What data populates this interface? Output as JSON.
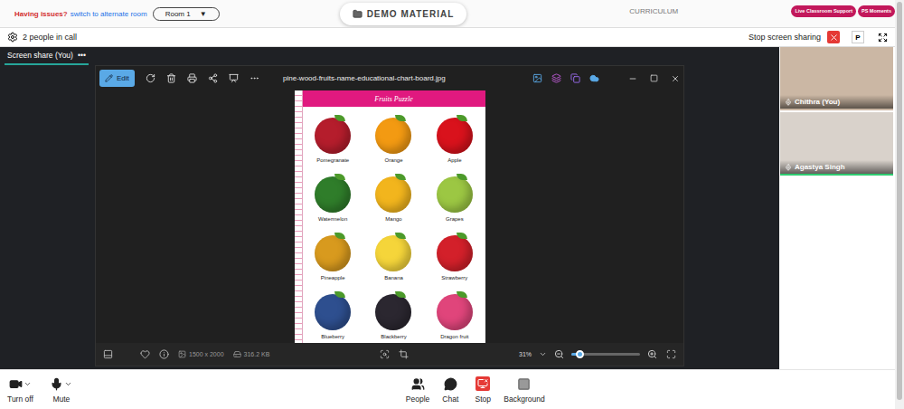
{
  "top_bar": {
    "issue_text": "Having issues?",
    "switch_link": "switch to alternate room",
    "room": "Room 1",
    "room_caret": "▼",
    "tabs": [
      {
        "label": "DEMO MATERIAL",
        "selected": true
      },
      {
        "label": "CURRICULUM",
        "selected": false
      }
    ],
    "actions": [
      "Live Classroom Support",
      "PS Moments"
    ]
  },
  "call_bar": {
    "people_count": "2 people in call",
    "stop_sharing": "Stop screen sharing",
    "avatar": "P"
  },
  "share_tab": {
    "label": "Screen share (You)",
    "menu": "•••",
    "selected": true
  },
  "viewer": {
    "edit": "Edit",
    "title": "pine-wood-fruits-name-educational-chart-board.jpg",
    "image_size": "1500 x 2000",
    "file_size": "316.2 KB",
    "zoom": "31%",
    "zoom_level": 0.12
  },
  "chart": {
    "title": "Fruits Puzzle",
    "fruits": [
      {
        "name": "Pomegranate",
        "color": "#b51d2c"
      },
      {
        "name": "Orange",
        "color": "#f39a12"
      },
      {
        "name": "Apple",
        "color": "#d9121c"
      },
      {
        "name": "Watermelon",
        "color": "#2f7d2a"
      },
      {
        "name": "Mango",
        "color": "#f2b51d"
      },
      {
        "name": "Grapes",
        "color": "#9cc743"
      },
      {
        "name": "Pineapple",
        "color": "#d89a1e"
      },
      {
        "name": "Banana",
        "color": "#f5d53a"
      },
      {
        "name": "Strawberry",
        "color": "#d3202a"
      },
      {
        "name": "Blueberry",
        "color": "#2e4f8f"
      },
      {
        "name": "Blackberry",
        "color": "#2b2730"
      },
      {
        "name": "Dragon fruit",
        "color": "#e0457b"
      }
    ]
  },
  "participants": [
    {
      "name": "Chithra (You)",
      "speaking": false
    },
    {
      "name": "Agastya Singh",
      "speaking": true
    }
  ],
  "controls": {
    "left": [
      {
        "label": "Turn off"
      },
      {
        "label": "Mute"
      }
    ],
    "center": [
      {
        "label": "People"
      },
      {
        "label": "Chat"
      },
      {
        "label": "Stop"
      },
      {
        "label": "Background"
      }
    ]
  }
}
